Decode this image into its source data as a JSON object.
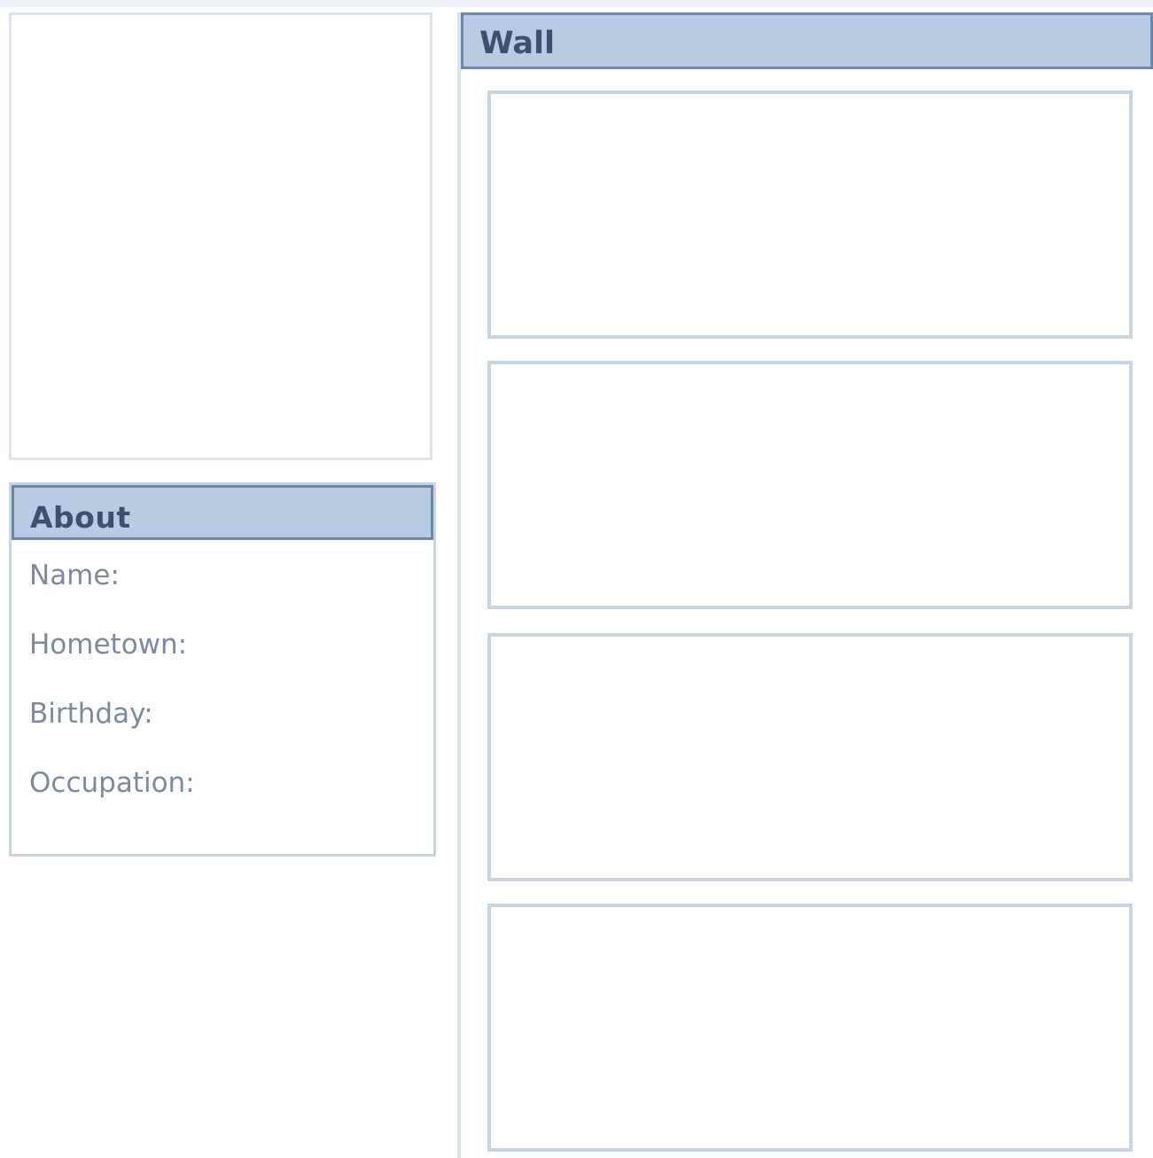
{
  "profile": {
    "photo_alt": ""
  },
  "about": {
    "title": "About",
    "fields": [
      {
        "label": "Name:"
      },
      {
        "label": "Hometown:"
      },
      {
        "label": "Birthday:"
      },
      {
        "label": "Occupation:"
      }
    ]
  },
  "wall": {
    "title": "Wall",
    "post_count": 4
  },
  "colors": {
    "header_bg": "#b9cbe3",
    "header_border": "#6d87ab",
    "title_text": "#3b5170",
    "label_text": "#7b8aa0",
    "panel_border": "#c9d4e3"
  }
}
